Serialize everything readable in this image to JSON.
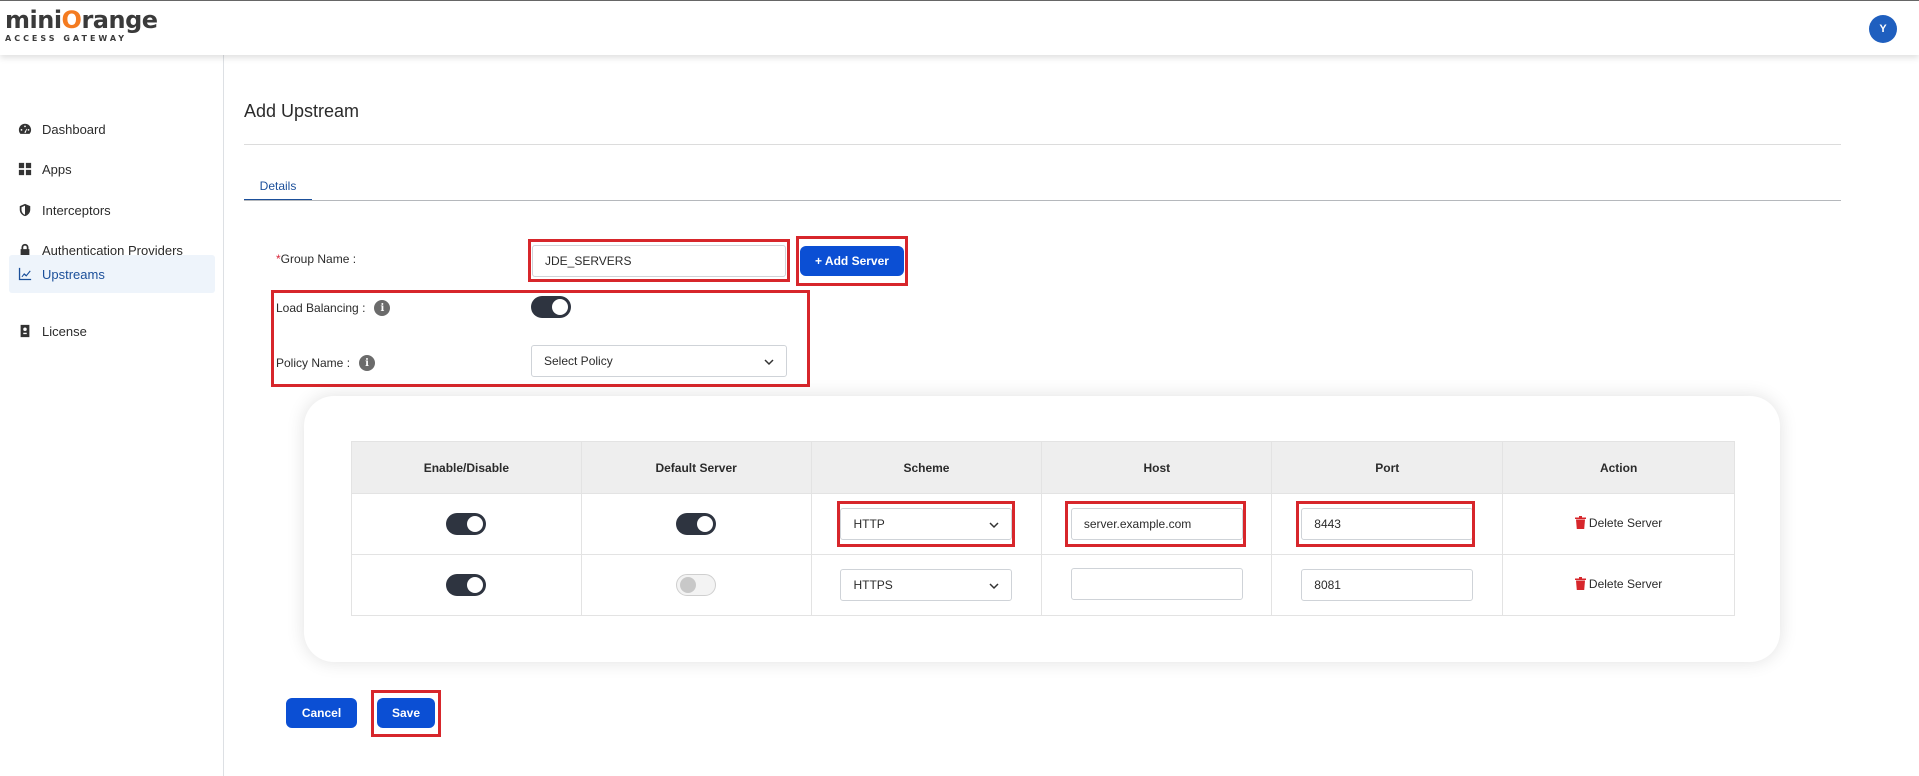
{
  "brand": {
    "name_part1": "mini",
    "name_o": "O",
    "name_part2": "range",
    "subtitle": "ACCESS GATEWAY"
  },
  "header": {
    "avatar_initial": "Y"
  },
  "sidebar": {
    "items": [
      {
        "label": "Dashboard",
        "icon": "dashboard-icon"
      },
      {
        "label": "Apps",
        "icon": "apps-grid-icon"
      },
      {
        "label": "Interceptors",
        "icon": "shield-icon"
      },
      {
        "label": "Authentication Providers",
        "icon": "lock-icon"
      },
      {
        "label": "Upstreams",
        "icon": "chart-line-icon",
        "active": true
      },
      {
        "label": "License",
        "icon": "license-icon"
      }
    ]
  },
  "page": {
    "title": "Add Upstream",
    "tab": "Details"
  },
  "form": {
    "group_name_required": "*",
    "group_name_label": "Group Name :",
    "group_name_value": "JDE_SERVERS",
    "add_server_label": "+ Add Server",
    "load_balancing_label": "Load Balancing :",
    "load_balancing_on": true,
    "policy_name_label": "Policy Name :",
    "policy_select_value": "Select Policy",
    "info_glyph": "i"
  },
  "table": {
    "headers": [
      "Enable/Disable",
      "Default Server",
      "Scheme",
      "Host",
      "Port",
      "Action"
    ],
    "rows": [
      {
        "enabled": true,
        "default": true,
        "scheme": "HTTP",
        "host": "server.example.com",
        "port": "8443",
        "action": "Delete Server"
      },
      {
        "enabled": true,
        "default": false,
        "scheme": "HTTPS",
        "host": "",
        "port": "8081",
        "action": "Delete Server"
      }
    ]
  },
  "footer": {
    "cancel_label": "Cancel",
    "save_label": "Save"
  },
  "colors": {
    "primary": "#0b4fd4",
    "highlight": "#d7262b",
    "brand_orange": "#f47b20",
    "toggle_on": "#2e3440"
  }
}
